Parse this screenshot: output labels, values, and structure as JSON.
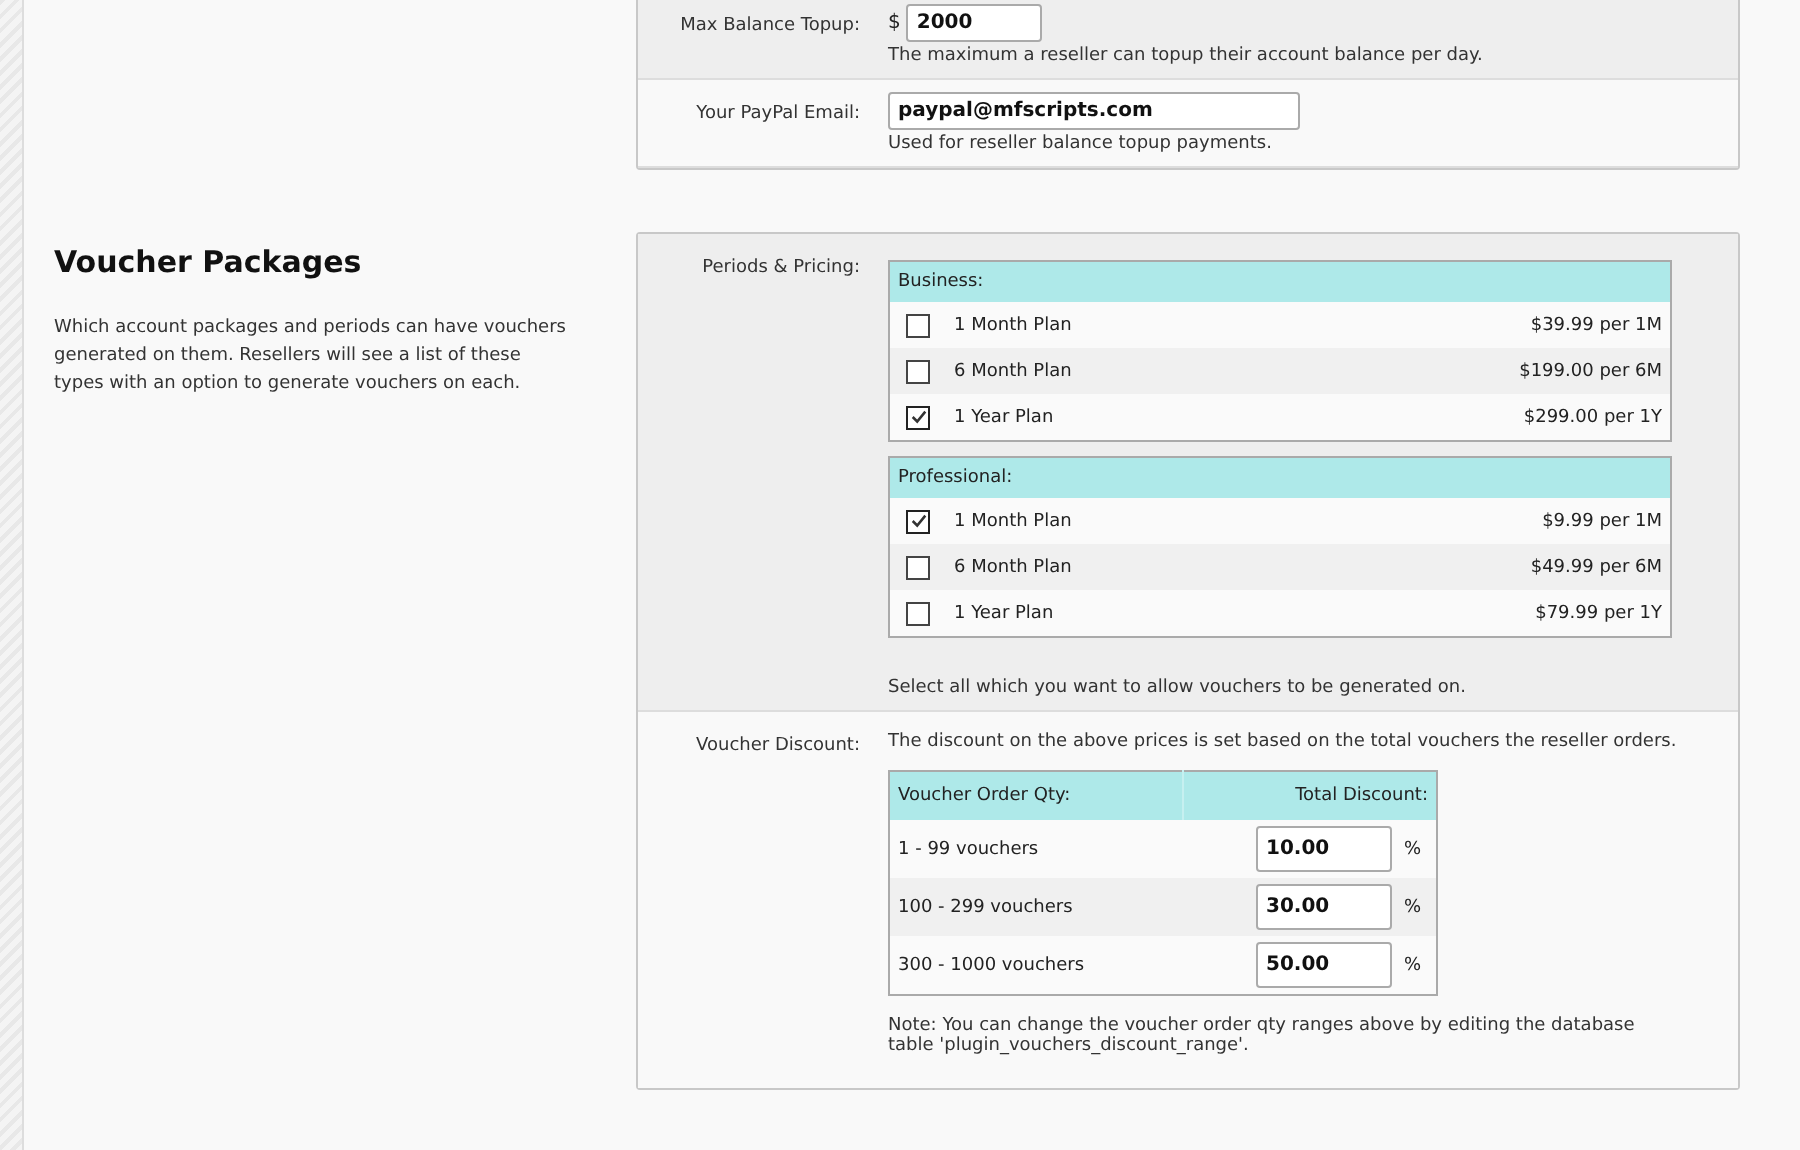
{
  "balance_panel": {
    "rows": [
      {
        "label": "Max Balance Topup:",
        "prefix": "$",
        "value": "2000",
        "help": "The maximum a reseller can topup their account balance per day."
      },
      {
        "label": "Your PayPal Email:",
        "value": "paypal@mfscripts.com",
        "help": "Used for reseller balance topup payments."
      }
    ]
  },
  "voucher_section": {
    "title": "Voucher Packages",
    "description": "Which account packages and periods can have vouchers generated on them. Resellers will see a list of these types with an option to generate vouchers on each."
  },
  "voucher_panel": {
    "periods_label": "Periods & Pricing:",
    "packages": [
      {
        "name": "Business:",
        "plans": [
          {
            "label": "1 Month Plan",
            "price": "$39.99 per 1M",
            "checked": false
          },
          {
            "label": "6 Month Plan",
            "price": "$199.00 per 6M",
            "checked": false
          },
          {
            "label": "1 Year Plan",
            "price": "$299.00 per 1Y",
            "checked": true
          }
        ]
      },
      {
        "name": "Professional:",
        "plans": [
          {
            "label": "1 Month Plan",
            "price": "$9.99 per 1M",
            "checked": true
          },
          {
            "label": "6 Month Plan",
            "price": "$49.99 per 6M",
            "checked": false
          },
          {
            "label": "1 Year Plan",
            "price": "$79.99 per 1Y",
            "checked": false
          }
        ]
      }
    ],
    "periods_help": "Select all which you want to allow vouchers to be generated on.",
    "discount_label": "Voucher Discount:",
    "discount_intro": "The discount on the above prices is set based on the total vouchers the reseller orders.",
    "discount_table": {
      "columns": [
        "Voucher Order Qty:",
        "Total Discount:"
      ],
      "rows": [
        {
          "range": "1 - 99 vouchers",
          "value": "10.00",
          "unit": "%"
        },
        {
          "range": "100 - 299 vouchers",
          "value": "30.00",
          "unit": "%"
        },
        {
          "range": "300 - 1000 vouchers",
          "value": "50.00",
          "unit": "%"
        }
      ]
    },
    "note": "Note: You can change the voucher order qty ranges above by editing the database table 'plugin_vouchers_discount_range'."
  }
}
